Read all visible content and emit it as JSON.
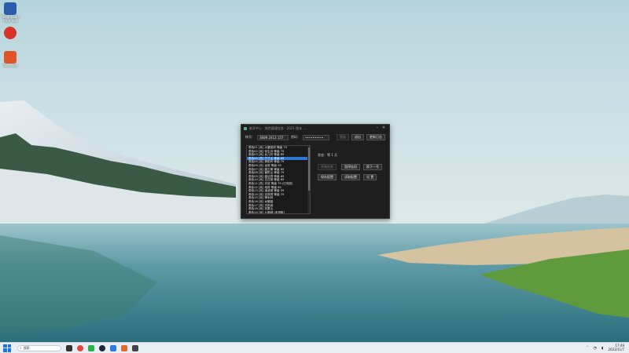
{
  "desktop": {
    "icons": [
      {
        "label": "Neighbours\nfrom Hell",
        "color": "#2b5ea8"
      },
      {
        "label": "",
        "color": "#d8312a"
      },
      {
        "label": "Illustrator",
        "color": "#e0542a"
      }
    ]
  },
  "window": {
    "title": "新开中心 · 角色管理任务 · 2021 版本 ...",
    "controls": {
      "minimize": "–",
      "maximize": "□",
      "close": "✕"
    }
  },
  "login": {
    "account_label": "帐号：",
    "account_value": "3689 2412 157",
    "password_label": "密码：",
    "password_value": "••••••••••",
    "login_button": "登陆",
    "exit_button": "退出",
    "help_button": "更新日志"
  },
  "character_list": [
    "角色01 [未] 大唐官府 等级 79",
    "角色02 [未] 化生寺 等级 79",
    "角色03 [未] 女儿村 等级 89",
    "角色04 [任] 方寸山 等级 69",
    "角色05 [未] 狮驼岭 等级 79",
    "角色06 [未] 龙宫 等级 59",
    "角色07 [未] 魔王寨 等级 69",
    "角色08 [未] 普陀山 等级 79",
    "角色09 [未] 盘丝洞 等级 89",
    "角色10 [未] 五庄观 等级 69",
    "角色11 [任] 天宫 等级 79 (已完成)",
    "角色12 [未] 地府 等级 69",
    "角色13 [未] 凌波城 等级 59",
    "角色14 [未] 无底洞 等级 79",
    "角色15 [未] 神木林",
    "角色16 [未] 女魃墓",
    "角色17 [未] 天机城",
    "角色18 [未] 花果山",
    "角色19 [未] 九黎城 (未领取)"
  ],
  "selected_index": 3,
  "panel": {
    "status_text": "状态：等 1 天",
    "buttons": {
      "disabled": "开始任务",
      "stop": "暂停挂机",
      "switch": "换下一号",
      "save": "保存配置",
      "load": "读取配置",
      "settings": "设 置"
    }
  },
  "taskbar": {
    "search_placeholder": "搜索",
    "clock_time": "17:49",
    "clock_date": "2023/11/7"
  }
}
